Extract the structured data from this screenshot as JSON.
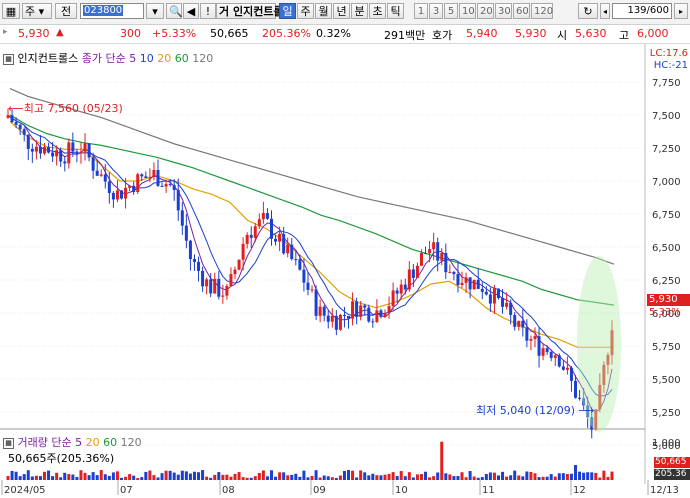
{
  "toolbar": {
    "type_label": "주",
    "prev_label": "전",
    "code_value": "023800",
    "stock_name": "인지컨트롤",
    "period_tabs": [
      "일",
      "주",
      "월",
      "년",
      "분",
      "초",
      "틱"
    ],
    "selected_period": "일",
    "interval_buttons": [
      "1",
      "3",
      "5",
      "10",
      "20",
      "30",
      "60",
      "120"
    ],
    "count_value": "139/600",
    "gu_label": "거"
  },
  "info": {
    "price": "5,930",
    "arrow": "▲",
    "change": "300",
    "change_pct": "+5.33%",
    "volume": "50,665",
    "volume_ratio": "205.36%",
    "turnover_pct": "0.32%",
    "trade_value": "291백만",
    "quote_label": "호가",
    "ask": "5,940",
    "bid": "5,930",
    "open_label": "시",
    "open": "5,630",
    "high_label": "고",
    "high": "6,000"
  },
  "legend": {
    "name": "인지컨트롤스",
    "ma_label": "종가 단순",
    "ma_periods": [
      "5",
      "10",
      "20",
      "60",
      "120"
    ],
    "ma_colors": [
      "#7a1fa2",
      "#1a3fd1",
      "#e6a000",
      "#1f9a3b",
      "#777777"
    ]
  },
  "right_labels": {
    "lc": "LC:17.6",
    "hc": "HC:-21"
  },
  "price_badge": {
    "price": "5,930",
    "pct": "5.33%"
  },
  "max_label": "최고 7,560 (05/23)",
  "min_label": "최저 5,040 (12/09)",
  "volume_panel": {
    "legend_label": "거래량",
    "ma_label": "단순",
    "ma_periods": [
      "5",
      "20",
      "60",
      "120"
    ],
    "value_text": "50,665주(205.36%)",
    "badge_value": "50,665",
    "badge_pct": "205.36"
  },
  "x_labels": [
    "2024/05",
    "07",
    "08",
    "09",
    "10",
    "11",
    "12",
    "12/13"
  ],
  "chart_data": {
    "type": "candlestick",
    "y_ticks": [
      "7,750",
      "7,500",
      "7,250",
      "7,000",
      "6,750",
      "6,500",
      "6,250",
      "6,000",
      "5,750",
      "5,500",
      "5,250",
      "5,000"
    ],
    "ylim": [
      4900,
      7850
    ],
    "vol_ticks": [
      "1,000"
    ],
    "ma120": [
      7700,
      7640,
      7600,
      7560,
      7520,
      7480,
      7430,
      7380,
      7330,
      7280,
      7240,
      7200,
      7160,
      7120,
      7080,
      7040,
      7000,
      6960,
      6920,
      6880,
      6850,
      6820,
      6790,
      6760,
      6730,
      6700,
      6660,
      6620,
      6580,
      6540,
      6500,
      6460,
      6420,
      6370
    ],
    "ma60": [
      7500,
      7420,
      7360,
      7320,
      7290,
      7270,
      7240,
      7210,
      7180,
      7140,
      7100,
      7050,
      7000,
      6950,
      6900,
      6850,
      6800,
      6740,
      6700,
      6650,
      6600,
      6540,
      6480,
      6440,
      6400,
      6360,
      6320,
      6280,
      6240,
      6180,
      6140,
      6100,
      6080,
      6060
    ],
    "ma20": [
      7450,
      7330,
      7260,
      7240,
      7240,
      7120,
      7000,
      7000,
      7040,
      7000,
      6940,
      6900,
      6840,
      6700,
      6640,
      6540,
      6420,
      6300,
      6160,
      6080,
      6040,
      6080,
      6140,
      6220,
      6240,
      6160,
      6040,
      5960,
      5900,
      5840,
      5800,
      5740,
      5740,
      5740
    ]
  }
}
